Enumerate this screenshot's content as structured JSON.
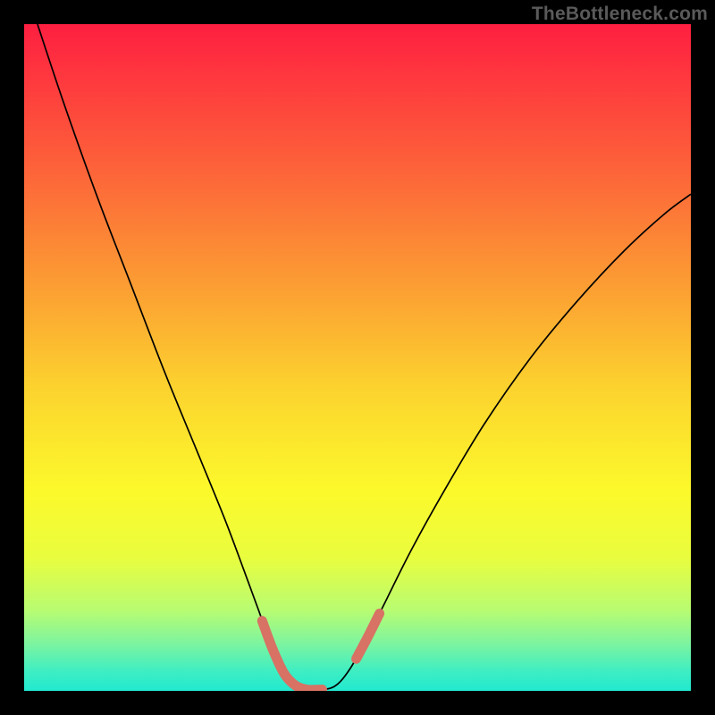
{
  "meta": {
    "watermark": "TheBottleneck.com"
  },
  "chart_data": {
    "type": "line",
    "title": "",
    "xlabel": "",
    "ylabel": "",
    "x_range": [
      0,
      100
    ],
    "y_range": [
      0,
      100
    ],
    "grid": false,
    "legend": false,
    "background_gradient": {
      "stops": [
        {
          "offset": 0.0,
          "color": "#fe1f41"
        },
        {
          "offset": 0.2,
          "color": "#fd5d3a"
        },
        {
          "offset": 0.4,
          "color": "#fca033"
        },
        {
          "offset": 0.55,
          "color": "#fcd42e"
        },
        {
          "offset": 0.7,
          "color": "#fcf92b"
        },
        {
          "offset": 0.8,
          "color": "#e9fd3e"
        },
        {
          "offset": 0.88,
          "color": "#b7fc72"
        },
        {
          "offset": 0.93,
          "color": "#7cf4a0"
        },
        {
          "offset": 0.97,
          "color": "#3feec2"
        },
        {
          "offset": 1.0,
          "color": "#21e9d0"
        }
      ]
    },
    "series": [
      {
        "name": "bottleneck-curve",
        "color": "#000000",
        "width": 1.7,
        "points": [
          {
            "x": 2.0,
            "y": 100.0
          },
          {
            "x": 6.0,
            "y": 88.0
          },
          {
            "x": 11.0,
            "y": 74.0
          },
          {
            "x": 16.0,
            "y": 61.0
          },
          {
            "x": 21.0,
            "y": 48.0
          },
          {
            "x": 25.5,
            "y": 37.0
          },
          {
            "x": 30.0,
            "y": 26.0
          },
          {
            "x": 33.0,
            "y": 18.0
          },
          {
            "x": 35.2,
            "y": 12.0
          },
          {
            "x": 37.0,
            "y": 7.0
          },
          {
            "x": 38.5,
            "y": 3.5
          },
          {
            "x": 40.0,
            "y": 1.0
          },
          {
            "x": 42.0,
            "y": 0.2
          },
          {
            "x": 45.0,
            "y": 0.2
          },
          {
            "x": 47.0,
            "y": 1.0
          },
          {
            "x": 49.0,
            "y": 3.5
          },
          {
            "x": 51.5,
            "y": 8.0
          },
          {
            "x": 54.0,
            "y": 13.0
          },
          {
            "x": 58.0,
            "y": 21.0
          },
          {
            "x": 63.0,
            "y": 30.0
          },
          {
            "x": 69.0,
            "y": 40.0
          },
          {
            "x": 76.0,
            "y": 50.0
          },
          {
            "x": 83.0,
            "y": 58.5
          },
          {
            "x": 90.0,
            "y": 66.0
          },
          {
            "x": 96.0,
            "y": 71.5
          },
          {
            "x": 100.0,
            "y": 74.5
          }
        ]
      },
      {
        "name": "highlight-segment-left",
        "color": "#d77265",
        "width": 11,
        "linecap": "round",
        "points": [
          {
            "x": 35.7,
            "y": 10.5
          },
          {
            "x": 37.3,
            "y": 6.2
          },
          {
            "x": 39.0,
            "y": 2.6
          },
          {
            "x": 40.7,
            "y": 0.8
          },
          {
            "x": 42.4,
            "y": 0.2
          },
          {
            "x": 44.7,
            "y": 0.2
          }
        ]
      },
      {
        "name": "highlight-segment-right",
        "color": "#d77265",
        "width": 11,
        "linecap": "round",
        "points": [
          {
            "x": 49.8,
            "y": 4.8
          },
          {
            "x": 51.5,
            "y": 8.0
          },
          {
            "x": 53.3,
            "y": 11.6
          }
        ]
      }
    ]
  }
}
